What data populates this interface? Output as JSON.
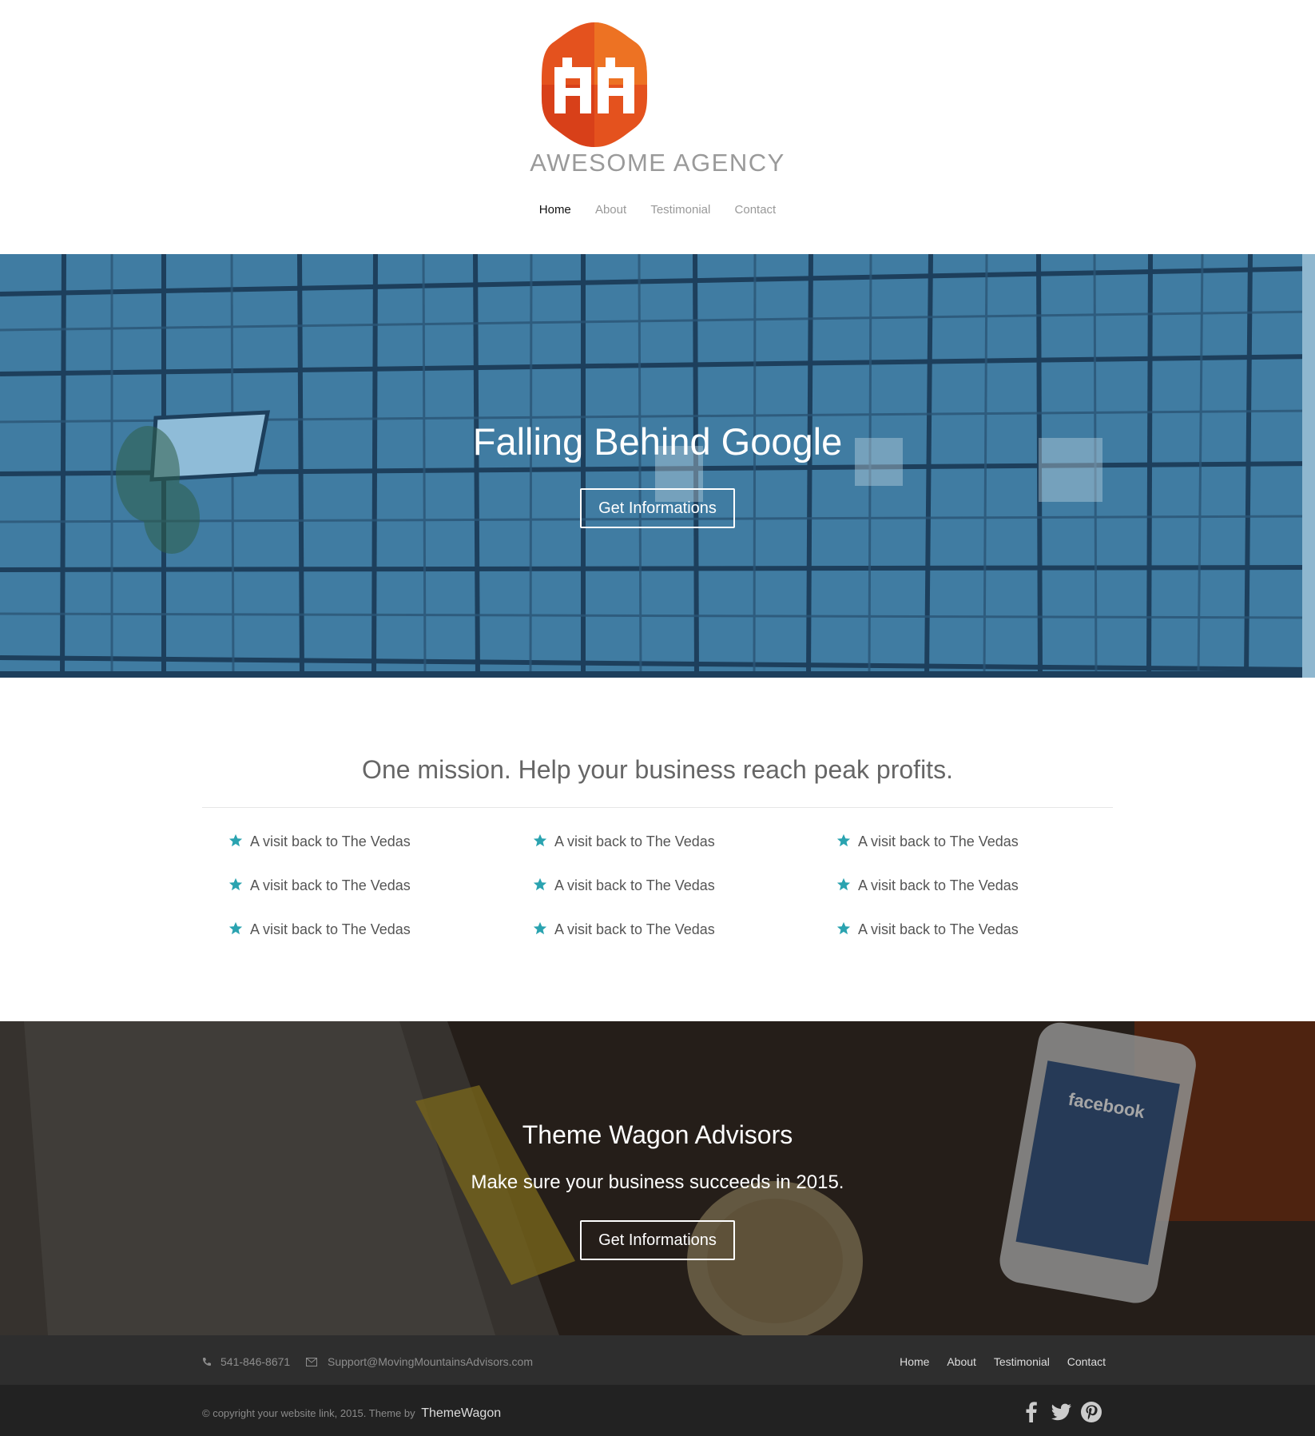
{
  "brand": {
    "name": "AWESOME AGENCY",
    "accent": "#e8581c"
  },
  "nav": [
    {
      "label": "Home",
      "active": true
    },
    {
      "label": "About",
      "active": false
    },
    {
      "label": "Testimonial",
      "active": false
    },
    {
      "label": "Contact",
      "active": false
    }
  ],
  "hero": {
    "title": "Falling Behind Google",
    "button": "Get Informations"
  },
  "mission": {
    "title": "One mission. Help your business reach peak profits.",
    "star_color": "#2aa3b0",
    "items": [
      "A visit back to The Vedas",
      "A visit back to The Vedas",
      "A visit back to The Vedas",
      "A visit back to The Vedas",
      "A visit back to The Vedas",
      "A visit back to The Vedas",
      "A visit back to The Vedas",
      "A visit back to The Vedas",
      "A visit back to The Vedas"
    ]
  },
  "advisors": {
    "title": "Theme Wagon Advisors",
    "subtitle": "Make sure your business succeeds in 2015.",
    "button": "Get Informations"
  },
  "footer": {
    "phone": "541-846-8671",
    "email": "Support@MovingMountainsAdvisors.com",
    "nav": [
      "Home",
      "About",
      "Testimonial",
      "Contact"
    ],
    "copyright": "© copyright your website link, 2015. Theme by",
    "theme_brand": "ThemeWagon",
    "social": [
      "facebook-icon",
      "twitter-icon",
      "pinterest-icon"
    ]
  }
}
